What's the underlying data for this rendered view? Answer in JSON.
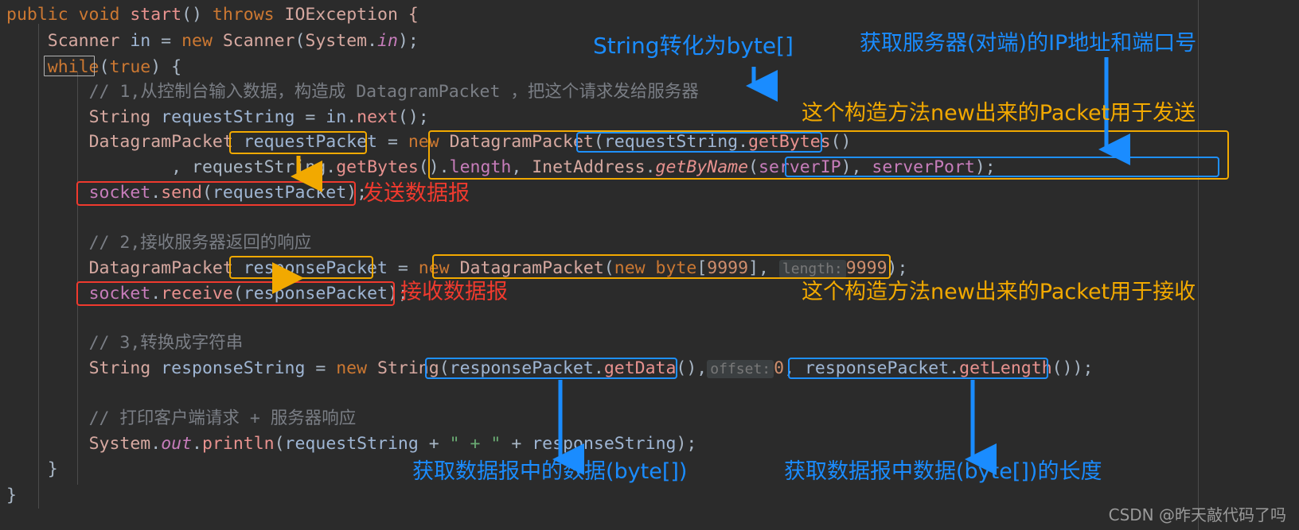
{
  "editor": {
    "theme_background": "#2b2b2b",
    "language": "Java",
    "code_lines": [
      "public void start() throws IOException {",
      "    Scanner in = new Scanner(System.in);",
      "    while(true) {",
      "        // 1,从控制台输入数据，构造成 DatagramPacket ，把这个请求发给服务器",
      "        String requestString = in.next();",
      "        DatagramPacket requestPacket = new DatagramPacket(requestString.getBytes()",
      "                , requestString.getBytes().length, InetAddress.getByName(serverIP), serverPort);",
      "        socket.send(requestPacket);",
      "",
      "        // 2,接收服务器返回的响应",
      "        DatagramPacket responsePacket = new DatagramPacket(new byte[9999], length: 9999);",
      "        socket.receive(responsePacket);",
      "",
      "        // 3,转换成字符串",
      "        String responseString = new String(responsePacket.getData(), offset: 0, responsePacket.getLength());",
      "",
      "        // 打印客户端请求 + 服务器响应",
      "        System.out.println(requestString + \" + \" + responseString);",
      "    }",
      "}"
    ],
    "tokens": {
      "l1": {
        "t1": "public",
        "t2": " void ",
        "t3": "start",
        "t4": "() ",
        "t5": "throws",
        "t6": " IOException {"
      },
      "l2": {
        "t1": "Scanner",
        "t2": " in ",
        "t3": "= ",
        "t4": "new",
        "t5": " Scanner",
        "t6": "(",
        "t7": "System",
        "t8": ".",
        "t9": "in",
        "t10": ");"
      },
      "l3": {
        "t1": "while",
        "t2": "(",
        "t3": "true",
        "t4": ") {"
      },
      "l4": {
        "t1": "// 1,从控制台输入数据，构造成 DatagramPacket ，把这个请求发给服务器"
      },
      "l5": {
        "t1": "String",
        "t2": " requestString ",
        "t3": "= ",
        "t4": "in",
        "t5": ".",
        "t6": "next",
        "t7": "();"
      },
      "l6": {
        "t1": "DatagramPacket",
        "t2": " requestPacket ",
        "t3": "= ",
        "t4": "new",
        "t5": " DatagramPacket",
        "t6": "(",
        "t7": "requestString",
        "t8": ".",
        "t9": "getBytes",
        "t10": "()"
      },
      "l7": {
        "t1": ", requestString",
        "t2": ".",
        "t3": "getBytes",
        "t4": "().",
        "t5": "length",
        "t6": ", ",
        "t7": "InetAddress",
        "t8": ".",
        "t9": "getByName",
        "t10": "(",
        "t11": "serverIP",
        "t12": "), ",
        "t13": "serverPort",
        "t14": ");"
      },
      "l8": {
        "t1": "socket",
        "t2": ".",
        "t3": "send",
        "t4": "(",
        "t5": "requestPacket",
        "t6": ");"
      },
      "l10": {
        "t1": "// 2,接收服务器返回的响应"
      },
      "l11": {
        "t1": "DatagramPacket",
        "t2": " responsePacket ",
        "t3": "= ",
        "t4": "new",
        "t5": " DatagramPacket",
        "t6": "(",
        "t7": "new",
        "t8": " byte",
        "t9": "[",
        "t10": "9999",
        "t11": "], ",
        "t12": "length:",
        "t13": "9999",
        "t14": ");"
      },
      "l12": {
        "t1": "socket",
        "t2": ".",
        "t3": "receive",
        "t4": "(",
        "t5": "responsePacket",
        "t6": ");"
      },
      "l14": {
        "t1": "// 3,转换成字符串"
      },
      "l15": {
        "t1": "String",
        "t2": " responseString ",
        "t3": "= ",
        "t4": "new",
        "t5": " String",
        "t6": "(",
        "t7": "responsePacket",
        "t8": ".",
        "t9": "getData",
        "t10": "(),",
        "t11": "offset:",
        "t12": "0",
        "t13": ", ",
        "t14": "responsePacket",
        "t15": ".",
        "t16": "getLength",
        "t17": "()",
        "t18": ");"
      },
      "l17": {
        "t1": "// 打印客户端请求 + 服务器响应"
      },
      "l18": {
        "t1": "System",
        "t2": ".",
        "t3": "out",
        "t4": ".",
        "t5": "println",
        "t6": "(",
        "t7": "requestString ",
        "t8": "+ ",
        "t9": "\" + \"",
        "t10": " + ",
        "t11": "responseString",
        "t12": ");"
      },
      "l19": {
        "t1": "}"
      },
      "l20": {
        "t1": "}"
      }
    }
  },
  "annotations": {
    "colors": {
      "blue": "#1a8cff",
      "red": "#f03a2e",
      "orange": "#f2a900"
    },
    "texts": [
      {
        "id": "a1",
        "text": "String转化为byte[]",
        "color": "blue"
      },
      {
        "id": "a2",
        "text": "获取服务器(对端)的IP地址和端口号",
        "color": "blue"
      },
      {
        "id": "a3",
        "text": "这个构造方法new出来的Packet用于发送",
        "color": "orange"
      },
      {
        "id": "a4",
        "text": "发送数据报",
        "color": "red"
      },
      {
        "id": "a5",
        "text": "接收数据报",
        "color": "red"
      },
      {
        "id": "a6",
        "text": "这个构造方法new出来的Packet用于接收",
        "color": "orange"
      },
      {
        "id": "a7",
        "text": "获取数据报中的数据(byte[])",
        "color": "blue"
      },
      {
        "id": "a8",
        "text": "获取数据报中数据(byte[])的长度",
        "color": "blue"
      }
    ]
  },
  "watermark": {
    "text": "CSDN @昨天敲代码了吗"
  }
}
